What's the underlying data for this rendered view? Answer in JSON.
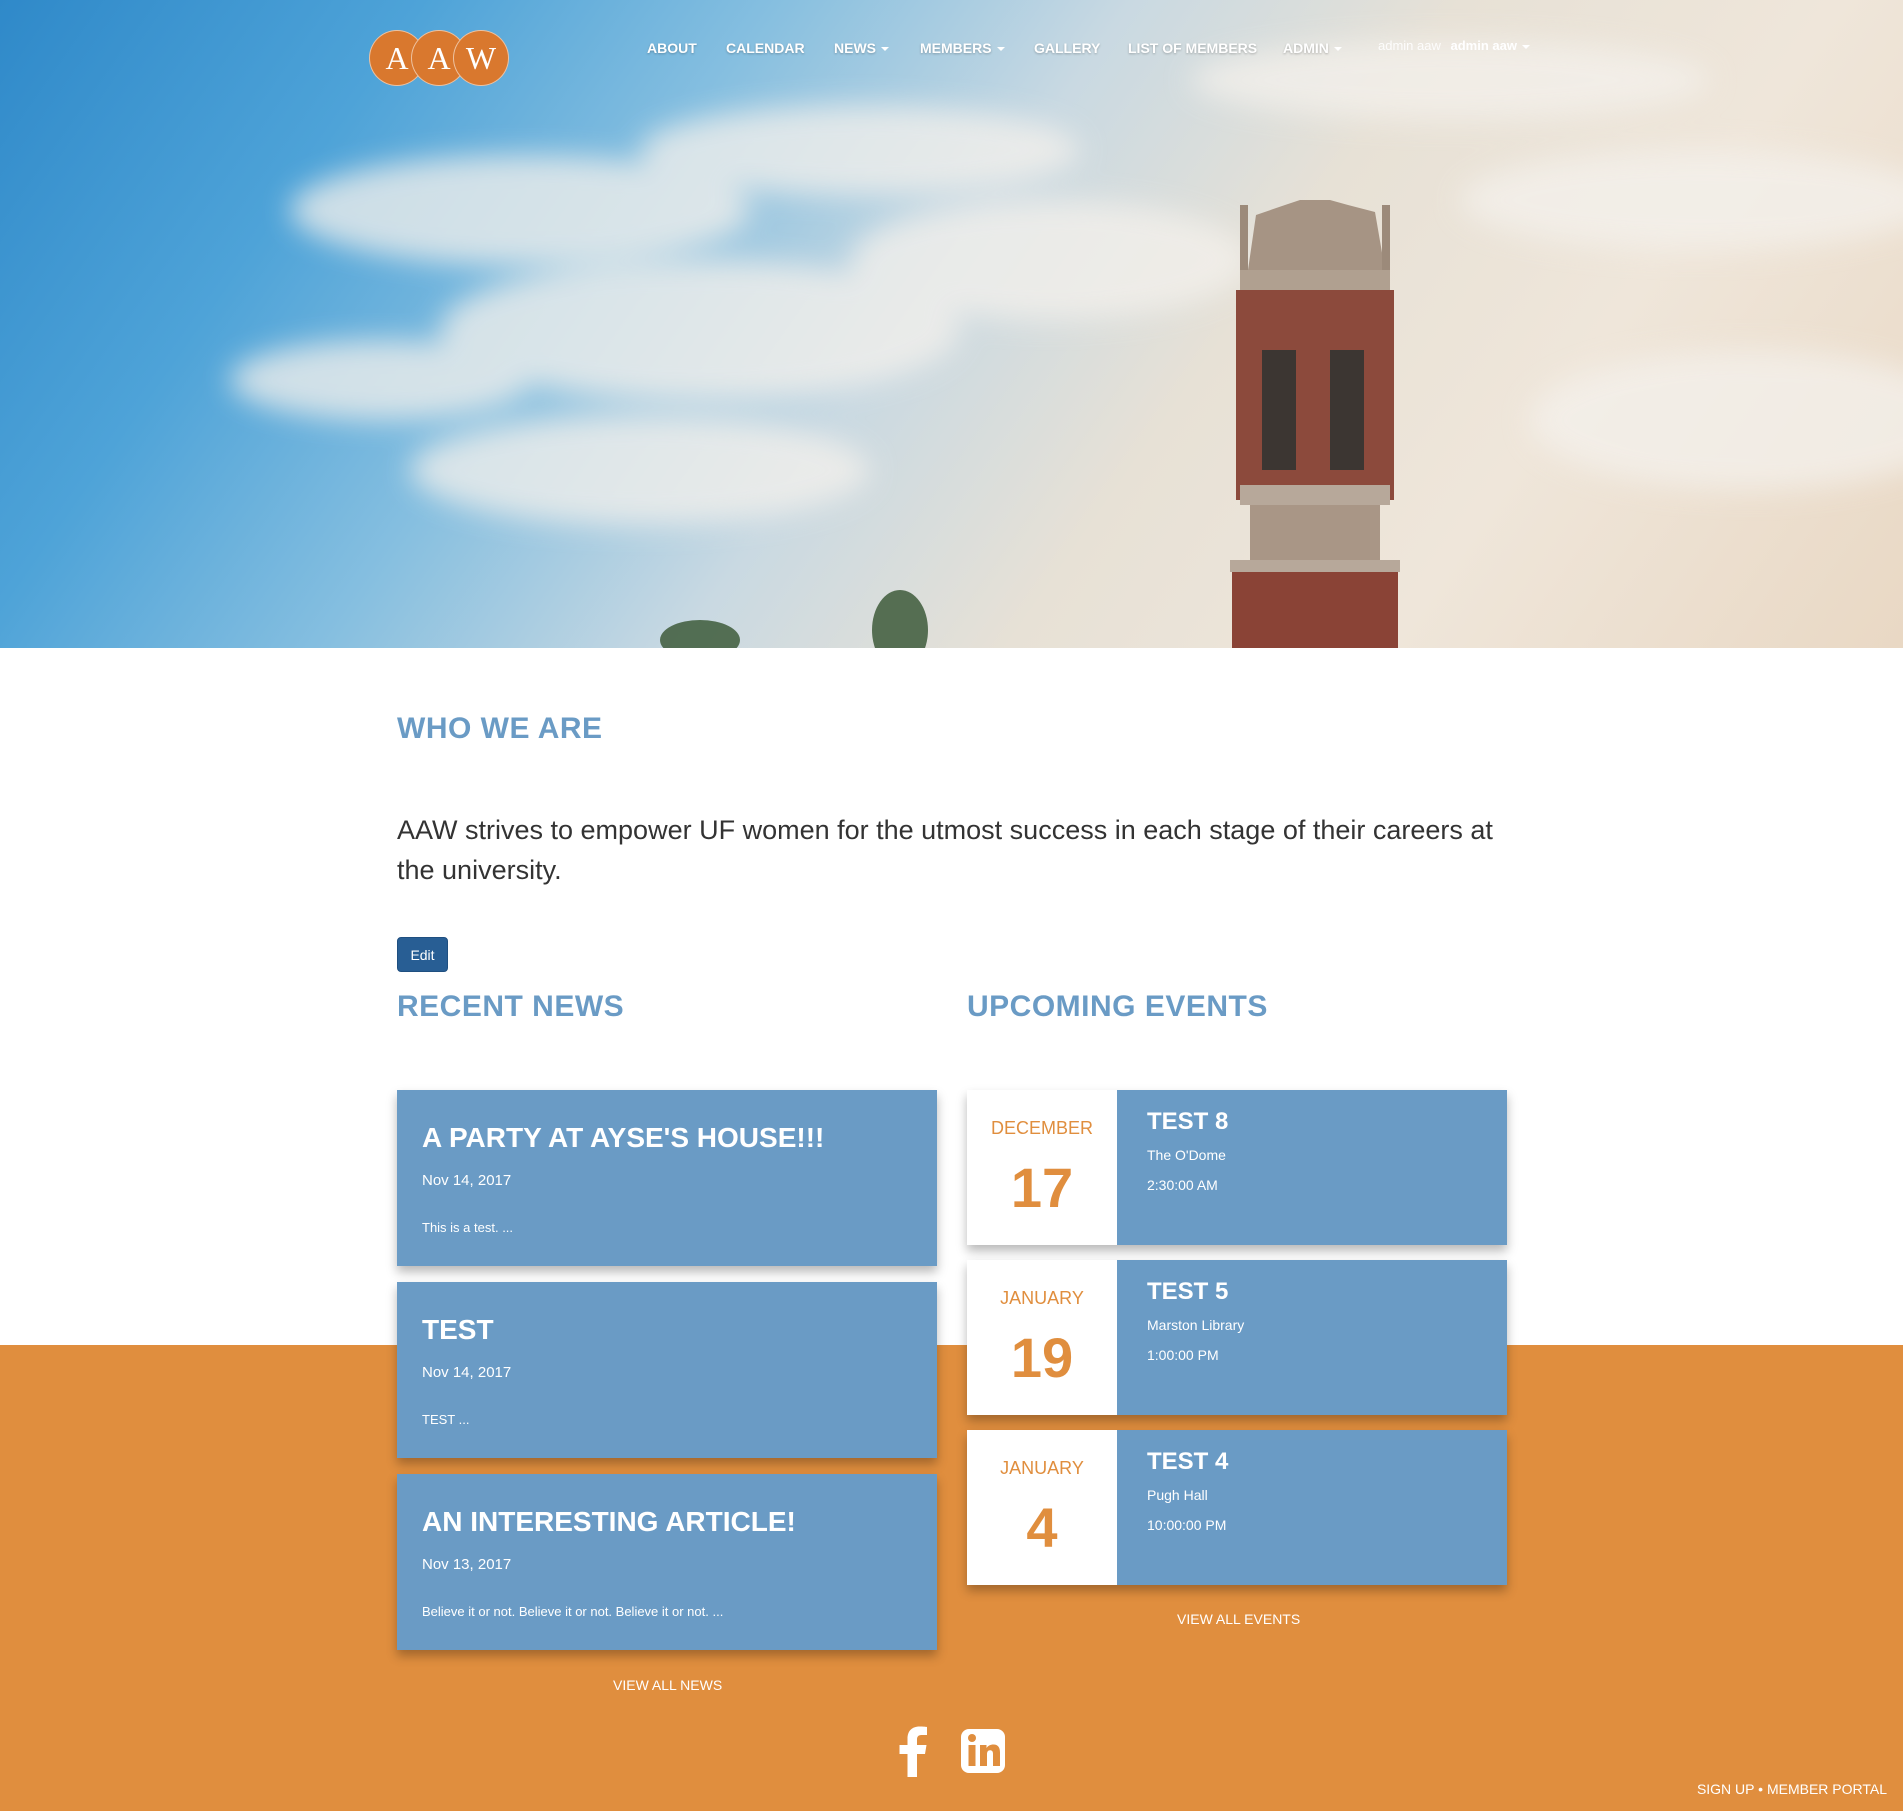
{
  "header": {
    "logo_letters": [
      "A",
      "A",
      "W"
    ],
    "nav": [
      {
        "label": "ABOUT",
        "dropdown": false
      },
      {
        "label": "CALENDAR",
        "dropdown": false
      },
      {
        "label": "NEWS",
        "dropdown": true
      },
      {
        "label": "MEMBERS",
        "dropdown": true
      },
      {
        "label": "GALLERY",
        "dropdown": false
      },
      {
        "label": "LIST OF MEMBERS",
        "dropdown": false
      },
      {
        "label": "ADMIN",
        "dropdown": true
      }
    ],
    "user_name": "admin aaw",
    "user_menu_label": "admin aaw"
  },
  "who_we_are": {
    "title": "WHO WE ARE",
    "text": "AAW strives to empower UF women for the utmost success in each stage of their careers at the university.",
    "edit_label": "Edit"
  },
  "recent_news": {
    "title": "RECENT NEWS",
    "items": [
      {
        "title": "A PARTY AT AYSE'S HOUSE!!!",
        "date": "Nov 14, 2017",
        "snippet": "This is a test. ..."
      },
      {
        "title": "TEST",
        "date": "Nov 14, 2017",
        "snippet": "TEST ..."
      },
      {
        "title": "AN INTERESTING ARTICLE!",
        "date": "Nov 13, 2017",
        "snippet": "Believe it or not. Believe it or not. Believe it or not. ..."
      }
    ],
    "view_all": "VIEW ALL NEWS"
  },
  "upcoming_events": {
    "title": "UPCOMING EVENTS",
    "items": [
      {
        "month": "DECEMBER",
        "day": "17",
        "title": "TEST 8",
        "location": "The O'Dome",
        "time": "2:30:00 AM"
      },
      {
        "month": "JANUARY",
        "day": "19",
        "title": "TEST 5",
        "location": "Marston Library",
        "time": "1:00:00 PM"
      },
      {
        "month": "JANUARY",
        "day": "4",
        "title": "TEST 4",
        "location": "Pugh Hall",
        "time": "10:00:00 PM"
      }
    ],
    "view_all": "VIEW ALL EVENTS"
  },
  "footer": {
    "social": [
      "facebook-icon",
      "linkedin-icon"
    ],
    "sign_up": "SIGN UP",
    "separator": "•",
    "member_portal": "MEMBER PORTAL"
  },
  "colors": {
    "accent_blue": "#6a9bc5",
    "orange": "#e08e3e",
    "button_blue": "#285e94"
  }
}
